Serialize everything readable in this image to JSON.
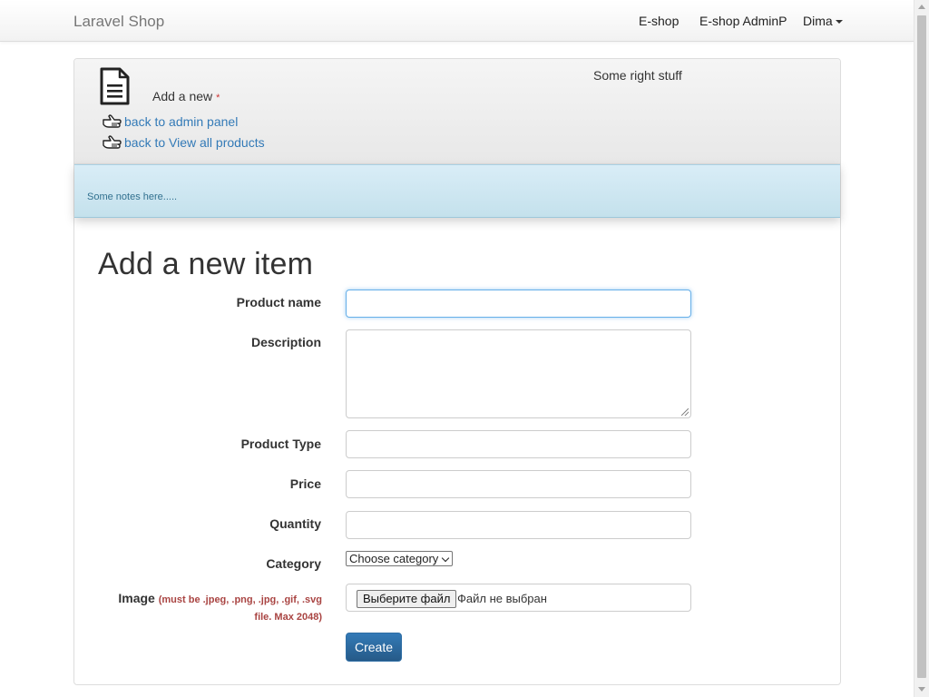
{
  "navbar": {
    "brand": "Laravel Shop",
    "links": [
      "E-shop",
      "E-shop AdminP"
    ],
    "user": "Dima"
  },
  "header": {
    "add_new_label": "Add a new",
    "required_mark": "*",
    "right_stuff": "Some right stuff",
    "back_links": [
      "back to admin panel",
      "back to View all products"
    ],
    "notes": "Some notes here....."
  },
  "form": {
    "title": "Add a new item",
    "fields": {
      "product_name": {
        "label": "Product name",
        "value": ""
      },
      "description": {
        "label": "Description",
        "value": ""
      },
      "product_type": {
        "label": "Product Type",
        "value": ""
      },
      "price": {
        "label": "Price",
        "value": ""
      },
      "quantity": {
        "label": "Quantity",
        "value": ""
      },
      "category": {
        "label": "Category",
        "selected": "Choose category"
      },
      "image": {
        "label": "Image",
        "hint": "(must be .jpeg, .png, .jpg, .gif, .svg file. Max 2048)",
        "button": "Выберите файл",
        "status": "Файл не выбран"
      }
    },
    "submit": "Create"
  },
  "icons": {
    "document": "document-icon",
    "back_hand": "pointing-hand-icon",
    "dropdown": "caret-down-icon"
  }
}
